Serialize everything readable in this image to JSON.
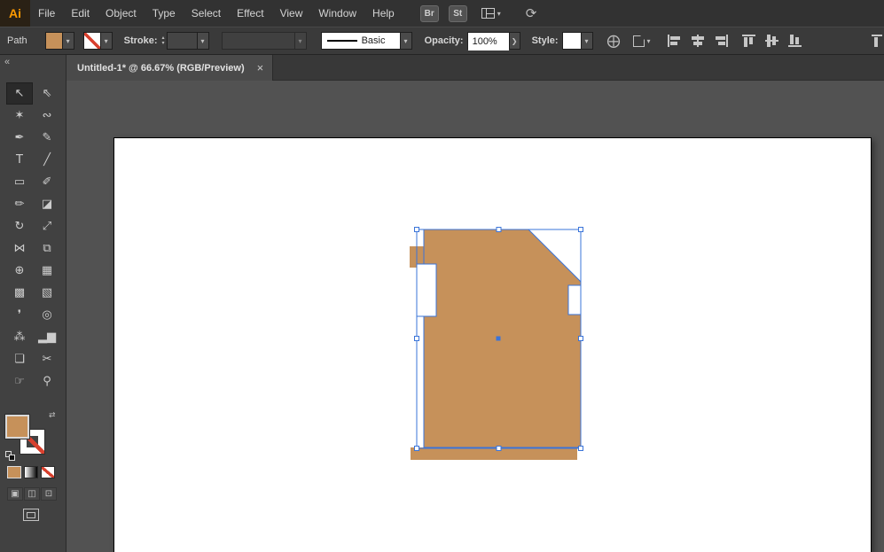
{
  "app": {
    "logo_text": "Ai"
  },
  "menu_bar": {
    "items": [
      "File",
      "Edit",
      "Object",
      "Type",
      "Select",
      "Effect",
      "View",
      "Window",
      "Help"
    ],
    "bridge_button": "Br",
    "stock_button": "St"
  },
  "control_bar": {
    "context_label": "Path",
    "stroke_label": "Stroke:",
    "stroke_style_value": "Basic",
    "opacity_label": "Opacity:",
    "opacity_value": "100%",
    "style_label": "Style:"
  },
  "tab_bar": {
    "document_title": "Untitled-1* @ 66.67% (RGB/Preview)",
    "close_glyph": "×"
  },
  "tools_panel": {
    "collapse_glyph": "«",
    "tools": [
      {
        "name": "selection",
        "glyph": "↖",
        "selected": true
      },
      {
        "name": "direct-selection",
        "glyph": "⇖"
      },
      {
        "name": "magic-wand",
        "glyph": "✶"
      },
      {
        "name": "lasso",
        "glyph": "∾"
      },
      {
        "name": "pen",
        "glyph": "✒"
      },
      {
        "name": "curvature",
        "glyph": "✎"
      },
      {
        "name": "type",
        "glyph": "T"
      },
      {
        "name": "line-segment",
        "glyph": "╱"
      },
      {
        "name": "rectangle",
        "glyph": "▭"
      },
      {
        "name": "paintbrush",
        "glyph": "✐"
      },
      {
        "name": "pencil",
        "glyph": "✏"
      },
      {
        "name": "eraser",
        "glyph": "◪"
      },
      {
        "name": "rotate",
        "glyph": "↻"
      },
      {
        "name": "scale",
        "glyph": "⤢"
      },
      {
        "name": "width",
        "glyph": "⋈"
      },
      {
        "name": "free-transform",
        "glyph": "⧉"
      },
      {
        "name": "shape-builder",
        "glyph": "⊕"
      },
      {
        "name": "perspective-grid",
        "glyph": "▦"
      },
      {
        "name": "mesh",
        "glyph": "▩"
      },
      {
        "name": "gradient",
        "glyph": "▧"
      },
      {
        "name": "eyedropper",
        "glyph": "❜"
      },
      {
        "name": "blend",
        "glyph": "◎"
      },
      {
        "name": "symbol-sprayer",
        "glyph": "⁂"
      },
      {
        "name": "column-graph",
        "glyph": "▂▆"
      },
      {
        "name": "artboard",
        "glyph": "❏"
      },
      {
        "name": "slice",
        "glyph": "✂"
      },
      {
        "name": "hand",
        "glyph": "☞"
      },
      {
        "name": "zoom",
        "glyph": "⚲"
      }
    ]
  },
  "icons": {
    "dropdown_glyph": "▾",
    "stepper_up_glyph": "▴",
    "stepper_down_glyph": "▾",
    "chevron_right_glyph": "❯",
    "swap_glyph": "⇄",
    "sync_glyph": "⟳",
    "globe_glyph": "⨁",
    "draw_normal_glyph": "▣",
    "draw_behind_glyph": "◫",
    "draw_inside_glyph": "⊡"
  },
  "colors": {
    "shape_fill": "#C6915A",
    "selection_blue": "#3A74D9",
    "none_red": "#D8402E",
    "logo_orange": "#FF9A00",
    "artboard_white": "#FFFFFF",
    "canvas_gray": "#525252"
  }
}
